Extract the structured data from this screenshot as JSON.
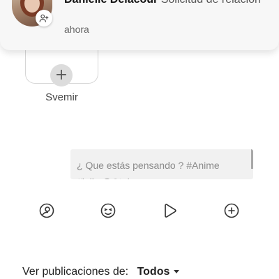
{
  "notification": {
    "sender": "Danielle Delacour",
    "message": " Solicitud de relación",
    "time": "ahora",
    "badge_icon": "add-user-icon"
  },
  "story": {
    "name": "Svemir",
    "add_icon": "plus-icon"
  },
  "composer": {
    "placeholder_line1": "¿ Que estás pensando ? #Anime",
    "placeholder_line2": "#lolis @Otakus"
  },
  "actions": [
    {
      "name": "photo-icon"
    },
    {
      "name": "emoji-icon"
    },
    {
      "name": "video-icon"
    },
    {
      "name": "add-icon"
    }
  ],
  "filter": {
    "label": "Ver publicaciones de:",
    "value": "Todos"
  },
  "colors": {
    "notification_bg": "#f7f7f7",
    "composer_bg": "#f1f1f1",
    "icon": "#333333"
  }
}
